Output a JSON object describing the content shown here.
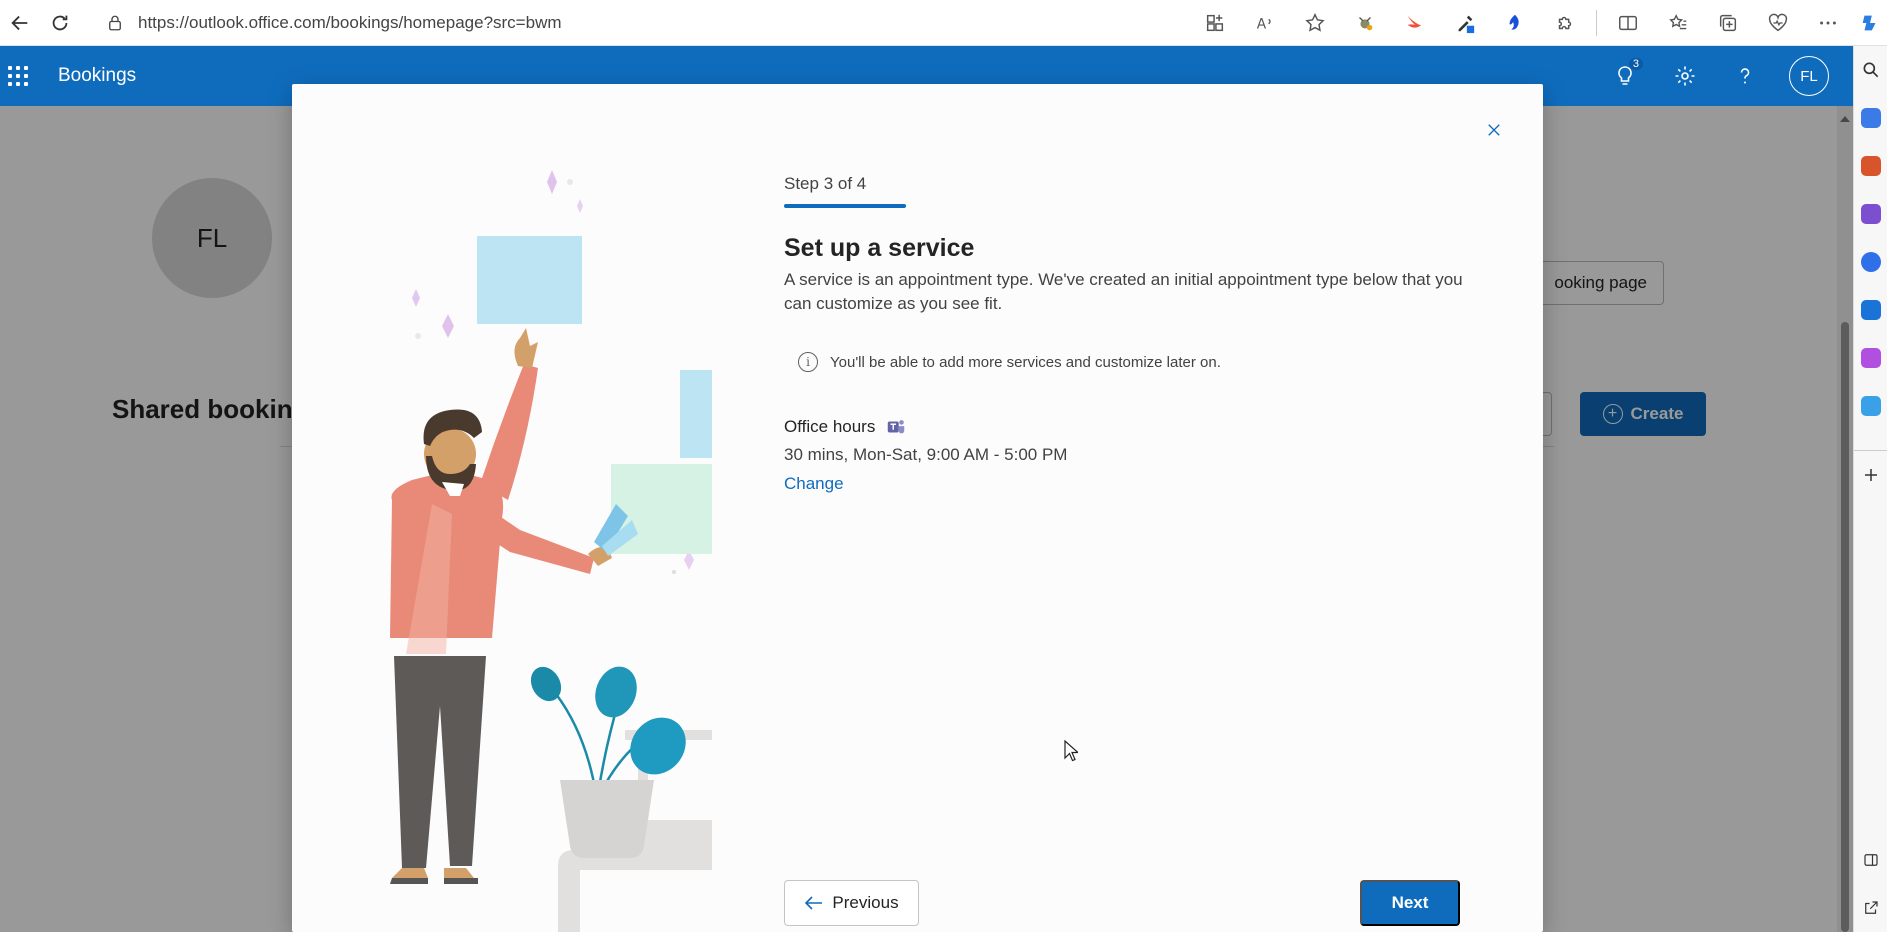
{
  "browser": {
    "url": "https://outlook.office.com/bookings/homepage?src=bwm",
    "toolbar_icons": [
      "split-window-icon",
      "read-aloud-icon",
      "favorite-star-icon",
      "extension-icon",
      "swift-icon",
      "color-picker-icon",
      "flame-icon",
      "puzzle-icon",
      "split-screen-icon",
      "favorites-icon",
      "collections-icon",
      "browser-health-icon",
      "more-icon"
    ]
  },
  "app": {
    "title": "Bookings",
    "notifications_count": "3",
    "avatar_initials": "FL"
  },
  "background_page": {
    "avatar_initials": "FL",
    "shared_heading": "Shared booking",
    "booking_page_btn": "ooking page",
    "create_btn": "Create"
  },
  "modal": {
    "step_label": "Step 3 of 4",
    "step_progress": 0.75,
    "title": "Set up a service",
    "description": "A service is an appointment type. We've created an initial appointment type below that you can customize as you see fit.",
    "info_text": "You'll be able to add more services and customize later on.",
    "service": {
      "name": "Office hours",
      "details": "30 mins, Mon-Sat, 9:00 AM - 5:00 PM",
      "change_label": "Change"
    },
    "previous_label": "Previous",
    "next_label": "Next"
  },
  "colors": {
    "brand": "#0f6cbd",
    "link": "#0f6cbd"
  }
}
